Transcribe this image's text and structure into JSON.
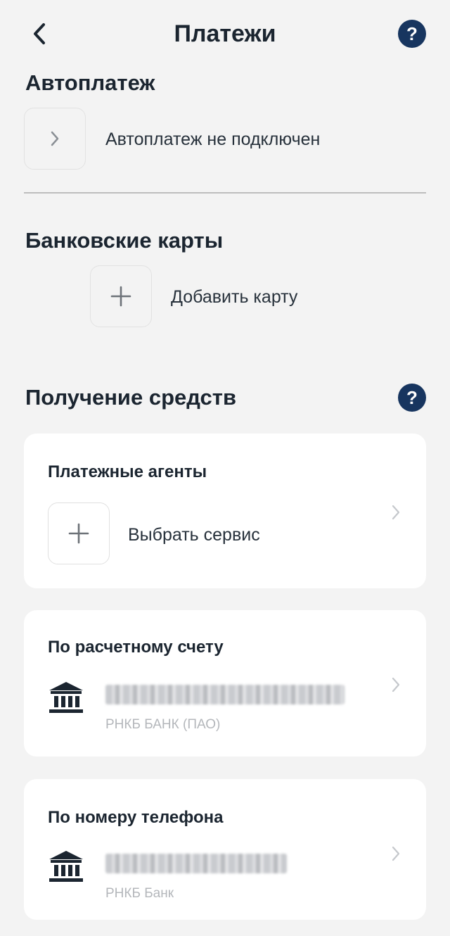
{
  "header": {
    "title": "Платежи",
    "back_icon": "chevron-left-icon",
    "help_icon_text": "?"
  },
  "autopayment": {
    "title": "Автоплатеж",
    "status_label": "Автоплатеж не подключен"
  },
  "bank_cards": {
    "title": "Банковские карты",
    "add_label": "Добавить карту"
  },
  "receiving_funds": {
    "title": "Получение средств",
    "help_icon_text": "?",
    "payment_agents": {
      "title": "Платежные агенты",
      "select_label": "Выбрать сервис"
    },
    "bank_account": {
      "title": "По расчетному счету",
      "bank_name": "РНКБ БАНК (ПАО)"
    },
    "phone_number": {
      "title": "По номеру телефона",
      "bank_name": "РНКБ Банк"
    }
  },
  "colors": {
    "background": "#f3f3f3",
    "accent": "#17355f",
    "card": "#ffffff",
    "muted_text": "#b4b7bb"
  }
}
